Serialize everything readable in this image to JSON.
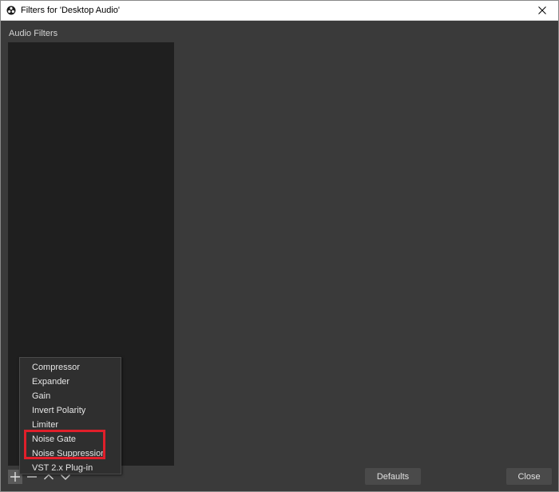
{
  "window": {
    "title": "Filters for 'Desktop Audio'"
  },
  "panel": {
    "section_label": "Audio Filters"
  },
  "toolbar": {
    "buttons": [
      "plus-icon",
      "minus-icon",
      "chevron-up-icon",
      "chevron-down-icon"
    ]
  },
  "buttons": {
    "defaults": "Defaults",
    "close": "Close"
  },
  "menu": {
    "items": [
      "Compressor",
      "Expander",
      "Gain",
      "Invert Polarity",
      "Limiter",
      "Noise Gate",
      "Noise Suppression",
      "VST 2.x Plug-in"
    ]
  },
  "colors": {
    "background": "#3a3a3a",
    "list_background": "#1f1f1f",
    "highlight": "#e01f2a"
  }
}
